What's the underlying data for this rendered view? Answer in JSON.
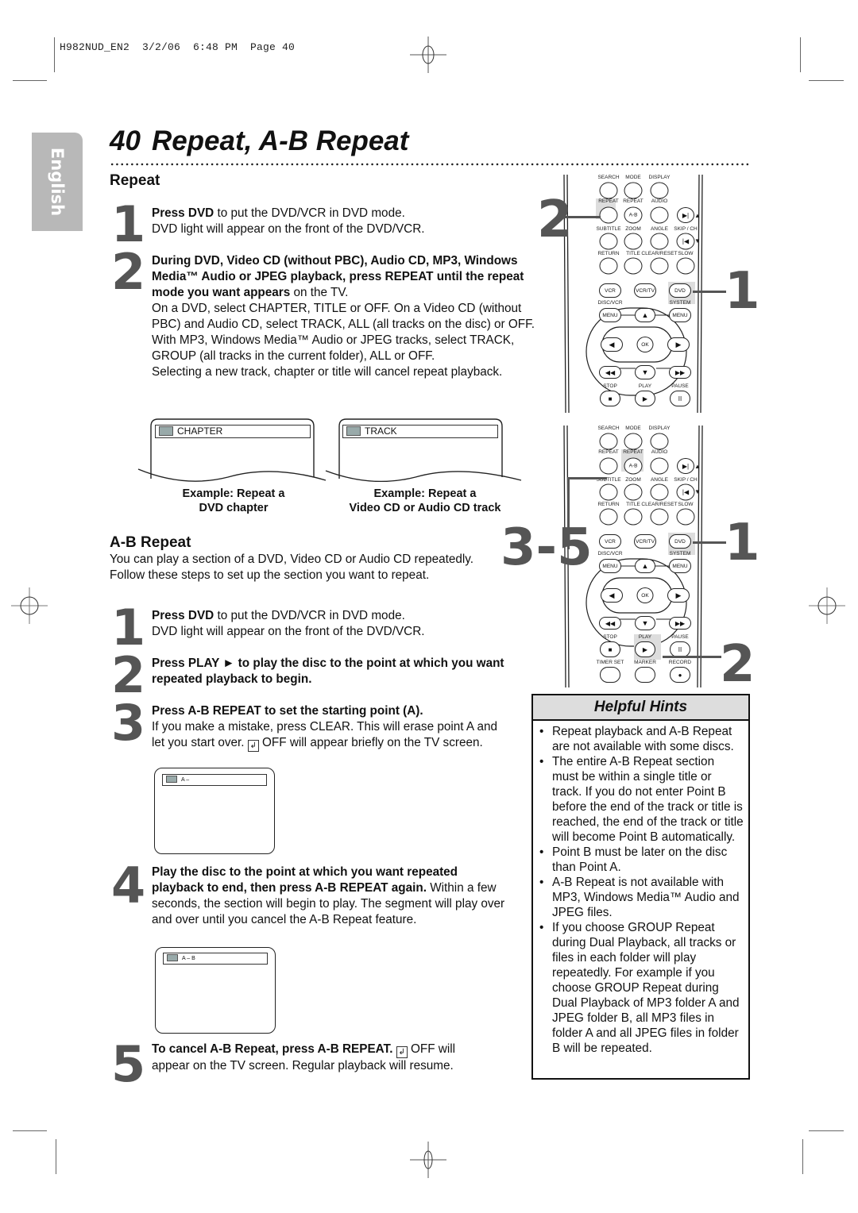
{
  "slug": "H982NUD_EN2  3/2/06  6:48 PM  Page 40",
  "language_tab": "English",
  "page_number": "40",
  "page_title": "Repeat, A-B Repeat",
  "repeat": {
    "heading": "Repeat",
    "steps": [
      {
        "num": "1",
        "bold": "Press DVD",
        "text": " to put the DVD/VCR in DVD mode.",
        "line2": "DVD light will appear on the front of the DVD/VCR."
      },
      {
        "num": "2",
        "bold": "During DVD, Video CD (without PBC), Audio CD, MP3, Windows Media™ Audio or JPEG playback, press REPEAT until the repeat mode you want appears",
        "text": " on the TV.",
        "para2": "On a DVD, select CHAPTER, TITLE or OFF.  On a Video CD (without PBC) and Audio CD, select TRACK, ALL (all tracks on the disc) or OFF.",
        "para3": "With MP3, Windows Media™ Audio or JPEG tracks, select TRACK, GROUP (all tracks in the current folder), ALL or OFF.",
        "para4": "Selecting a new track, chapter or title will cancel repeat playback."
      }
    ],
    "examples": [
      {
        "screen_text": "CHAPTER",
        "caption1": "Example: Repeat a",
        "caption2": "DVD chapter"
      },
      {
        "screen_text": "TRACK",
        "caption1": "Example: Repeat a",
        "caption2": "Video CD or Audio CD track"
      }
    ]
  },
  "ab_repeat": {
    "heading": "A-B Repeat",
    "intro": "You can play a section of a DVD, Video CD or Audio CD repeatedly. Follow these steps to set up the section you want to repeat.",
    "steps": [
      {
        "num": "1",
        "bold": "Press DVD",
        "text": " to put the DVD/VCR in DVD mode.",
        "line2": "DVD light will appear on the front of the DVD/VCR."
      },
      {
        "num": "2",
        "bold": "Press PLAY ► to play the disc to the point at which you want repeated playback to begin."
      },
      {
        "num": "3",
        "bold": "Press A-B REPEAT to set the starting point (A).",
        "text": "If you make a mistake, press CLEAR. This will erase point A and let you start over.",
        "off_text": " OFF will appear briefly on the TV screen.",
        "screen_text": "A –"
      },
      {
        "num": "4",
        "bold": "Play the disc to the point at which you want repeated playback to end, then press A-B REPEAT again.",
        "text": " Within a few seconds, the section will begin to play. The segment will play over and over until you cancel the A-B Repeat feature.",
        "screen_text": "A – B"
      },
      {
        "num": "5",
        "bold": "To cancel A-B Repeat, press A-B REPEAT.",
        "off_text": " OFF will",
        "text": "appear on the TV screen. Regular playback will resume."
      }
    ]
  },
  "hints": {
    "title": "Helpful Hints",
    "items": [
      "Repeat playback and A-B Repeat are not available with some discs.",
      "The entire A-B Repeat section must be within a single title or track. If you do not enter Point B before the end of the track or title is reached, the end of the track or title will become Point B automatically.",
      "Point B must be later on the disc than Point A.",
      "A-B Repeat is not available with MP3, Windows Media™ Audio and JPEG files.",
      "If you choose GROUP Repeat during Dual Playback, all tracks or files in each folder will play repeatedly. For example if you choose GROUP Repeat during Dual Playback of MP3 folder A and JPEG folder B, all MP3 files in folder A and all JPEG files in folder B will be repeated."
    ]
  },
  "remote_callouts": {
    "top_left": "2",
    "top_right": "1",
    "bottom_left": "3-5",
    "bottom_right_1": "1",
    "bottom_right_2": "2"
  },
  "remote_labels": {
    "row1": [
      "SEARCH",
      "MODE",
      "DISPLAY"
    ],
    "row2": [
      "REPEAT",
      "REPEAT",
      "AUDIO"
    ],
    "ab": "A-B",
    "row3": [
      "SUBTITLE",
      "ZOOM",
      "ANGLE",
      "SKIP / CH"
    ],
    "row4": [
      "RETURN",
      "TITLE",
      "CLEAR/RESET",
      "SLOW"
    ],
    "row5": [
      "VCR",
      "VCR/TV",
      "DVD"
    ],
    "disc_vcr": "DISC/VCR",
    "system": "SYSTEM",
    "menu": "MENU",
    "ok": "OK",
    "transport": [
      "STOP",
      "PLAY",
      "PAUSE"
    ],
    "bottom": [
      "TIMER SET",
      "MARKER",
      "RECORD"
    ]
  }
}
